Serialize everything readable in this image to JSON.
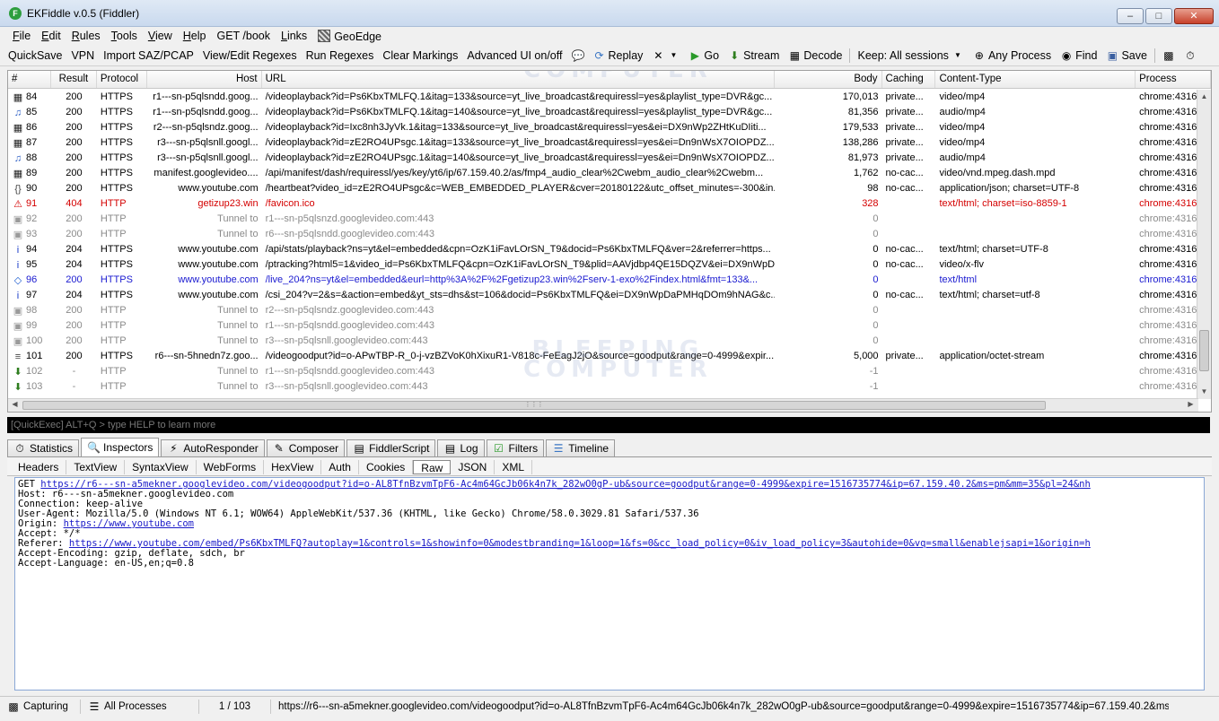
{
  "window": {
    "title": "EKFiddle v.0.5 (Fiddler)",
    "app_icon_letter": "F",
    "buttons": [
      "minimize-icon",
      "maximize-icon",
      "close-icon"
    ]
  },
  "menu": [
    {
      "ul": "F",
      "rest": "ile"
    },
    {
      "ul": "E",
      "rest": "dit"
    },
    {
      "ul": "R",
      "rest": "ules"
    },
    {
      "ul": "T",
      "rest": "ools"
    },
    {
      "ul": "V",
      "rest": "iew"
    },
    {
      "ul": "H",
      "rest": "elp"
    },
    {
      "ul": "",
      "rest": "GET /book"
    },
    {
      "ul": "L",
      "rest": "inks"
    },
    {
      "ul": "",
      "rest": "GeoEdge"
    }
  ],
  "toolbar": {
    "quicksave": "QuickSave",
    "vpn": "VPN",
    "import": "Import SAZ/PCAP",
    "view_regexes": "View/Edit Regexes",
    "run_regexes": "Run Regexes",
    "clear_markings": "Clear Markings",
    "advanced_ui": "Advanced UI on/off",
    "replay": "Replay",
    "go": "Go",
    "stream": "Stream",
    "decode": "Decode",
    "keep": "Keep: All sessions",
    "any_process": "Any Process",
    "find": "Find",
    "save": "Save"
  },
  "grid": {
    "columns": [
      "#",
      "Result",
      "Protocol",
      "Host",
      "URL",
      "Body",
      "Caching",
      "Content-Type",
      "Process"
    ],
    "rows": [
      {
        "icon": "video-icon",
        "num": "84",
        "result": "200",
        "protocol": "HTTPS",
        "host": "r1---sn-p5qlsndd.goog...",
        "url": "/videoplayback?id=Ps6KbxTMLFQ.1&itag=133&source=yt_live_broadcast&requiressl=yes&playlist_type=DVR&gc...",
        "body": "170,013",
        "caching": "private...",
        "content_type": "video/mp4",
        "process": "chrome:4316",
        "style": ""
      },
      {
        "icon": "audio-icon",
        "num": "85",
        "result": "200",
        "protocol": "HTTPS",
        "host": "r1---sn-p5qlsndd.goog...",
        "url": "/videoplayback?id=Ps6KbxTMLFQ.1&itag=140&source=yt_live_broadcast&requiressl=yes&playlist_type=DVR&gc...",
        "body": "81,356",
        "caching": "private...",
        "content_type": "audio/mp4",
        "process": "chrome:4316",
        "style": ""
      },
      {
        "icon": "video-icon",
        "num": "86",
        "result": "200",
        "protocol": "HTTPS",
        "host": "r2---sn-p5qlsndz.goog...",
        "url": "/videoplayback?id=Ixc8nh3JyVk.1&itag=133&source=yt_live_broadcast&requiressl=yes&ei=DX9nWp2ZHtKuDIiti...",
        "body": "179,533",
        "caching": "private...",
        "content_type": "video/mp4",
        "process": "chrome:4316",
        "style": ""
      },
      {
        "icon": "video-icon",
        "num": "87",
        "result": "200",
        "protocol": "HTTPS",
        "host": "r3---sn-p5qlsnll.googl...",
        "url": "/videoplayback?id=zE2RO4UPsgc.1&itag=133&source=yt_live_broadcast&requiressl=yes&ei=Dn9nWsX7OIOPDZ...",
        "body": "138,286",
        "caching": "private...",
        "content_type": "video/mp4",
        "process": "chrome:4316",
        "style": ""
      },
      {
        "icon": "audio-icon",
        "num": "88",
        "result": "200",
        "protocol": "HTTPS",
        "host": "r3---sn-p5qlsnll.googl...",
        "url": "/videoplayback?id=zE2RO4UPsgc.1&itag=140&source=yt_live_broadcast&requiressl=yes&ei=Dn9nWsX7OIOPDZ...",
        "body": "81,973",
        "caching": "private...",
        "content_type": "audio/mp4",
        "process": "chrome:4316",
        "style": ""
      },
      {
        "icon": "video-icon",
        "num": "89",
        "result": "200",
        "protocol": "HTTPS",
        "host": "manifest.googlevideo....",
        "url": "/api/manifest/dash/requiressl/yes/key/yt6/ip/67.159.40.2/as/fmp4_audio_clear%2Cwebm_audio_clear%2Cwebm...",
        "body": "1,762",
        "caching": "no-cac...",
        "content_type": "video/vnd.mpeg.dash.mpd",
        "process": "chrome:4316",
        "style": ""
      },
      {
        "icon": "json-icon",
        "num": "90",
        "result": "200",
        "protocol": "HTTPS",
        "host": "www.youtube.com",
        "url": "/heartbeat?video_id=zE2RO4UPsgc&c=WEB_EMBEDDED_PLAYER&cver=20180122&utc_offset_minutes=-300&in...",
        "body": "98",
        "caching": "no-cac...",
        "content_type": "application/json; charset=UTF-8",
        "process": "chrome:4316",
        "style": ""
      },
      {
        "icon": "warning-icon",
        "num": "91",
        "result": "404",
        "protocol": "HTTP",
        "host": "getizup23.win",
        "url": "/favicon.ico",
        "body": "328",
        "caching": "",
        "content_type": "text/html; charset=iso-8859-1",
        "process": "chrome:4316",
        "style": "red"
      },
      {
        "icon": "lock-icon",
        "num": "92",
        "result": "200",
        "protocol": "HTTP",
        "host": "Tunnel to",
        "url": "r1---sn-p5qlsnzd.googlevideo.com:443",
        "body": "0",
        "caching": "",
        "content_type": "",
        "process": "chrome:4316",
        "style": "gray"
      },
      {
        "icon": "lock-icon",
        "num": "93",
        "result": "200",
        "protocol": "HTTP",
        "host": "Tunnel to",
        "url": "r6---sn-p5qlsndd.googlevideo.com:443",
        "body": "0",
        "caching": "",
        "content_type": "",
        "process": "chrome:4316",
        "style": "gray"
      },
      {
        "icon": "info-icon",
        "num": "94",
        "result": "204",
        "protocol": "HTTPS",
        "host": "www.youtube.com",
        "url": "/api/stats/playback?ns=yt&el=embedded&cpn=OzK1iFavLOrSN_T9&docid=Ps6KbxTMLFQ&ver=2&referrer=https...",
        "body": "0",
        "caching": "no-cac...",
        "content_type": "text/html; charset=UTF-8",
        "process": "chrome:4316",
        "style": ""
      },
      {
        "icon": "info-icon",
        "num": "95",
        "result": "204",
        "protocol": "HTTPS",
        "host": "www.youtube.com",
        "url": "/ptracking?html5=1&video_id=Ps6KbxTMLFQ&cpn=OzK1iFavLOrSN_T9&plid=AAVjdbp4QE15DQZV&ei=DX9nWpD...",
        "body": "0",
        "caching": "no-cac...",
        "content_type": "video/x-flv",
        "process": "chrome:4316",
        "style": ""
      },
      {
        "icon": "html-icon",
        "num": "96",
        "result": "200",
        "protocol": "HTTPS",
        "host": "www.youtube.com",
        "url": "/live_204?ns=yt&el=embedded&eurl=http%3A%2F%2Fgetizup23.win%2Fserv-1-exo%2Findex.html&fmt=133&...",
        "body": "0",
        "caching": "",
        "content_type": "text/html",
        "process": "chrome:4316",
        "style": "blue"
      },
      {
        "icon": "info-icon",
        "num": "97",
        "result": "204",
        "protocol": "HTTPS",
        "host": "www.youtube.com",
        "url": "/csi_204?v=2&s=&action=embed&yt_sts=dhs&st=106&docid=Ps6KbxTMLFQ&ei=DX9nWpDaPMHqDOm9hNAG&c...",
        "body": "0",
        "caching": "no-cac...",
        "content_type": "text/html; charset=utf-8",
        "process": "chrome:4316",
        "style": ""
      },
      {
        "icon": "lock-icon",
        "num": "98",
        "result": "200",
        "protocol": "HTTP",
        "host": "Tunnel to",
        "url": "r2---sn-p5qlsndz.googlevideo.com:443",
        "body": "0",
        "caching": "",
        "content_type": "",
        "process": "chrome:4316",
        "style": "gray"
      },
      {
        "icon": "lock-icon",
        "num": "99",
        "result": "200",
        "protocol": "HTTP",
        "host": "Tunnel to",
        "url": "r1---sn-p5qlsndd.googlevideo.com:443",
        "body": "0",
        "caching": "",
        "content_type": "",
        "process": "chrome:4316",
        "style": "gray"
      },
      {
        "icon": "lock-icon",
        "num": "100",
        "result": "200",
        "protocol": "HTTP",
        "host": "Tunnel to",
        "url": "r3---sn-p5qlsnll.googlevideo.com:443",
        "body": "0",
        "caching": "",
        "content_type": "",
        "process": "chrome:4316",
        "style": "gray"
      },
      {
        "icon": "document-icon",
        "num": "101",
        "result": "200",
        "protocol": "HTTPS",
        "host": "r6---sn-5hnedn7z.goo...",
        "url": "/videogoodput?id=o-APwTBP-R_0-j-vzBZVoK0hXixuR1-V818c-FeEagJ2jO&source=goodput&range=0-4999&expir...",
        "body": "5,000",
        "caching": "private...",
        "content_type": "application/octet-stream",
        "process": "chrome:4316",
        "style": ""
      },
      {
        "icon": "download-icon",
        "num": "102",
        "result": "-",
        "protocol": "HTTP",
        "host": "Tunnel to",
        "url": "r1---sn-p5qlsndd.googlevideo.com:443",
        "body": "-1",
        "caching": "",
        "content_type": "",
        "process": "chrome:4316",
        "style": "gray"
      },
      {
        "icon": "download-icon",
        "num": "103",
        "result": "-",
        "protocol": "HTTP",
        "host": "Tunnel to",
        "url": "r3---sn-p5qlsnll.googlevideo.com:443",
        "body": "-1",
        "caching": "",
        "content_type": "",
        "process": "chrome:4316",
        "style": "gray"
      }
    ]
  },
  "watermark": {
    "line1": "BLEEPING",
    "line2": "COMPUTER"
  },
  "quickexec": "[QuickExec] ALT+Q > type HELP to learn more",
  "tabs": [
    "Statistics",
    "Inspectors",
    "AutoResponder",
    "Composer",
    "FiddlerScript",
    "Log",
    "Filters",
    "Timeline"
  ],
  "active_tab": "Inspectors",
  "subtabs": [
    "Headers",
    "TextView",
    "SyntaxView",
    "WebForms",
    "HexView",
    "Auth",
    "Cookies",
    "Raw",
    "JSON",
    "XML"
  ],
  "active_subtab": "Raw",
  "raw": {
    "get_prefix": "GET ",
    "get_url": "https://r6---sn-a5mekner.googlevideo.com/videogoodput?id=o-AL8TfnBzvmTpF6-Ac4m64GcJb06k4n7k_282wO0gP-ub&source=goodput&range=0-4999&expire=1516735774&ip=67.159.40.2&ms=pm&mm=35&pl=24&nh",
    "host": "Host: r6---sn-a5mekner.googlevideo.com",
    "connection": "Connection: keep-alive",
    "user_agent": "User-Agent: Mozilla/5.0 (Windows NT 6.1; WOW64) AppleWebKit/537.36 (KHTML, like Gecko) Chrome/58.0.3029.81 Safari/537.36",
    "origin_prefix": "Origin: ",
    "origin_url": "https://www.youtube.com",
    "accept": "Accept: */*",
    "referer_prefix": "Referer: ",
    "referer_url": "https://www.youtube.com/embed/Ps6KbxTMLFQ?autoplay=1&controls=1&showinfo=0&modestbranding=1&loop=1&fs=0&cc_load_policy=0&iv_load_policy=3&autohide=0&vq=small&enablejsapi=1&origin=h",
    "accept_encoding": "Accept-Encoding: gzip, deflate, sdch, br",
    "accept_language": "Accept-Language: en-US,en;q=0.8"
  },
  "status": {
    "capturing": "Capturing",
    "processes": "All Processes",
    "count": "1 / 103",
    "url": "https://r6---sn-a5mekner.googlevideo.com/videogoodput?id=o-AL8TfnBzvmTpF6-Ac4m64GcJb06k4n7k_282wO0gP-ub&source=goodput&range=0-4999&expire=1516735774&ip=67.159.40.2&ms=pm&mm="
  },
  "colors": {
    "red_row": "#d40000",
    "blue_row": "#1a1ad0",
    "gray_row": "#8a8a8a",
    "link": "#1a1ac8"
  }
}
